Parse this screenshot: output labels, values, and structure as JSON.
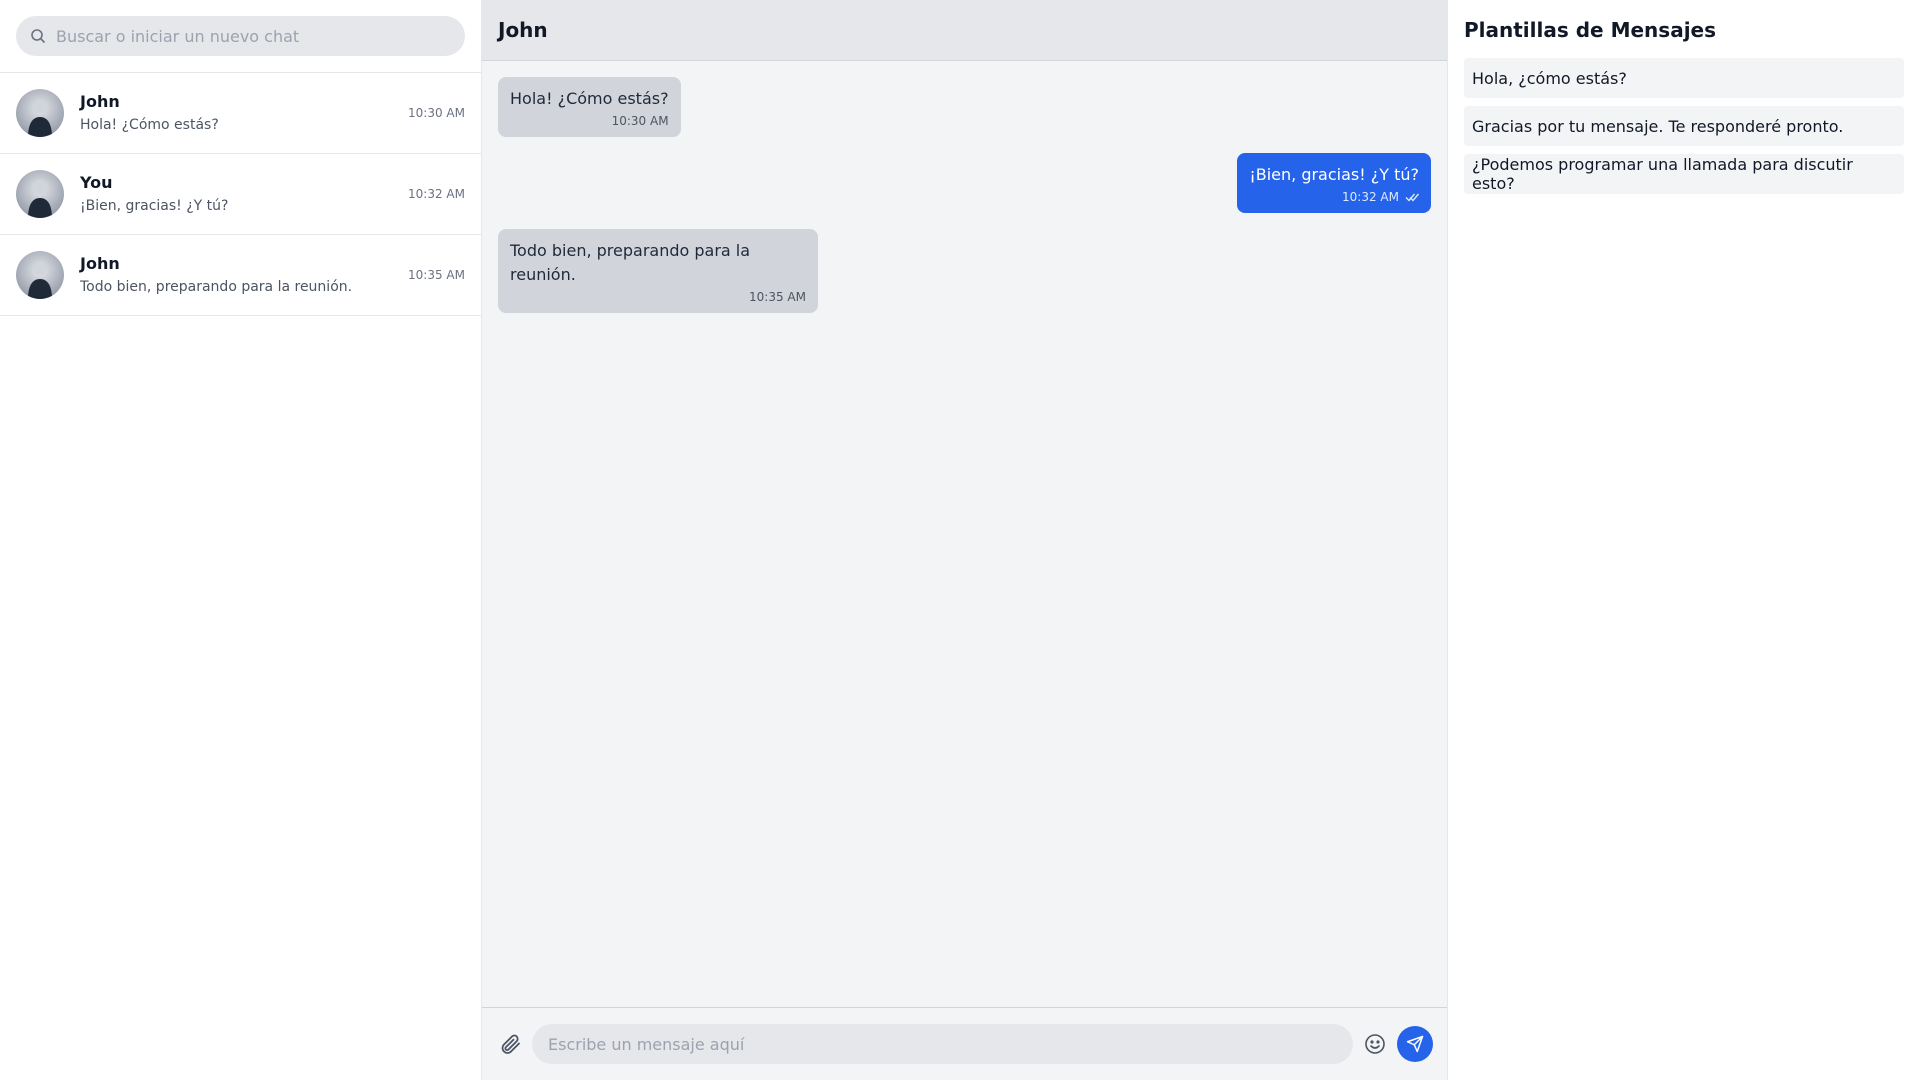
{
  "search": {
    "placeholder": "Buscar o iniciar un nuevo chat"
  },
  "chats": [
    {
      "name": "John",
      "preview": "Hola! ¿Cómo estás?",
      "time": "10:30 AM"
    },
    {
      "name": "You",
      "preview": "¡Bien, gracias! ¿Y tú?",
      "time": "10:32 AM"
    },
    {
      "name": "John",
      "preview": "Todo bien, preparando para la reunión.",
      "time": "10:35 AM"
    }
  ],
  "conversation": {
    "title": "John",
    "messages": [
      {
        "direction": "in",
        "text": "Hola! ¿Cómo estás?",
        "time": "10:30 AM"
      },
      {
        "direction": "out",
        "text": "¡Bien, gracias! ¿Y tú?",
        "time": "10:32 AM",
        "status_icon": "double-check-icon"
      },
      {
        "direction": "in",
        "text": "Todo bien, preparando para la reunión.",
        "time": "10:35 AM"
      }
    ]
  },
  "composer": {
    "placeholder": "Escribe un mensaje aquí",
    "icons": [
      "paperclip-icon",
      "emoji-icon",
      "send-icon"
    ]
  },
  "templates": {
    "title": "Plantillas de Mensajes",
    "items": [
      "Hola, ¿cómo estás?",
      "Gracias por tu mensaje. Te responderé pronto.",
      "¿Podemos programar una llamada para discutir esto?"
    ]
  },
  "colors": {
    "accent": "#2563eb",
    "incoming_bubble": "#d1d5db",
    "chat_bg": "#f3f4f6"
  }
}
